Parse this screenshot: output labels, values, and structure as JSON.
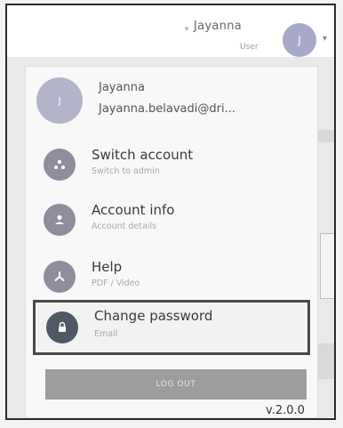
{
  "header": {
    "user_name": "Jayanna",
    "user_role": "User",
    "avatar_initial": "J"
  },
  "profile": {
    "avatar_initial": "J",
    "name": "Jayanna",
    "email": "Jayanna.belavadi@dri..."
  },
  "menu": {
    "items": [
      {
        "label": "Switch account",
        "sub": "Switch to admin",
        "icon": "switch-account-icon"
      },
      {
        "label": "Account info",
        "sub": "Account details",
        "icon": "person-icon"
      },
      {
        "label": "Help",
        "sub": "PDF / Video",
        "icon": "help-icon"
      },
      {
        "label": "Change password",
        "sub": "Email",
        "icon": "lock-icon"
      }
    ]
  },
  "logout_label": "LOG OUT",
  "version": "v.2.0.0",
  "colors": {
    "avatar": "#a8a8c8",
    "icon_bg": "#8d8d9d",
    "selected_icon_bg": "#505866",
    "logout_bg": "#9d9d9d",
    "highlight_border": "#4a4a4a"
  }
}
